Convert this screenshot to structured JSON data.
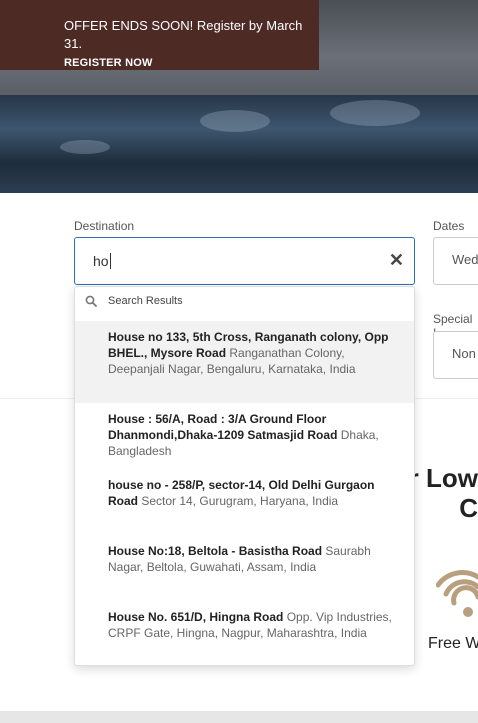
{
  "promo": {
    "offer_text": "OFFER ENDS SOON! Register by March 31.",
    "cta_label": "REGISTER NOW"
  },
  "booking": {
    "destination_label": "Destination",
    "destination_value": "ho",
    "dates_label": "Dates",
    "dates_value": "Wed",
    "special_label": "Special I",
    "special_value": "Non"
  },
  "dropdown": {
    "header": "Search Results",
    "results": [
      {
        "bold": "House no 133, 5th Cross, Ranganath colony, Opp BHEL., Mysore Road",
        "rest": " Ranganathan Colony, Deepanjali Nagar, Bengaluru, Karnataka, India"
      },
      {
        "bold": "House : 56/A, Road : 3/A Ground Floor Dhanmondi,Dhaka-1209 Satmasjid Road",
        "rest": " Dhaka, Bangladesh"
      },
      {
        "bold": "house no - 258/P, sector-14, Old Delhi Gurgaon Road",
        "rest": " Sector 14, Gurugram, Haryana, India"
      },
      {
        "bold": "House No:18, Beltola - Basistha Road",
        "rest": " Saurabh Nagar, Beltola, Guwahati, Assam, India"
      },
      {
        "bold": "House No. 651/D, Hingna Road",
        "rest": " Opp. Vip Industries, CRPF Gate, Hingna, Nagpur, Maharashtra, India"
      }
    ]
  },
  "lower": {
    "heading_line1": "r Low",
    "heading_line2": "C",
    "amenity_label": "Free W"
  },
  "colors": {
    "promo_bg": "#4e2a25",
    "focus_border": "#2a6fb8",
    "wifi_icon": "#b8a07e"
  }
}
